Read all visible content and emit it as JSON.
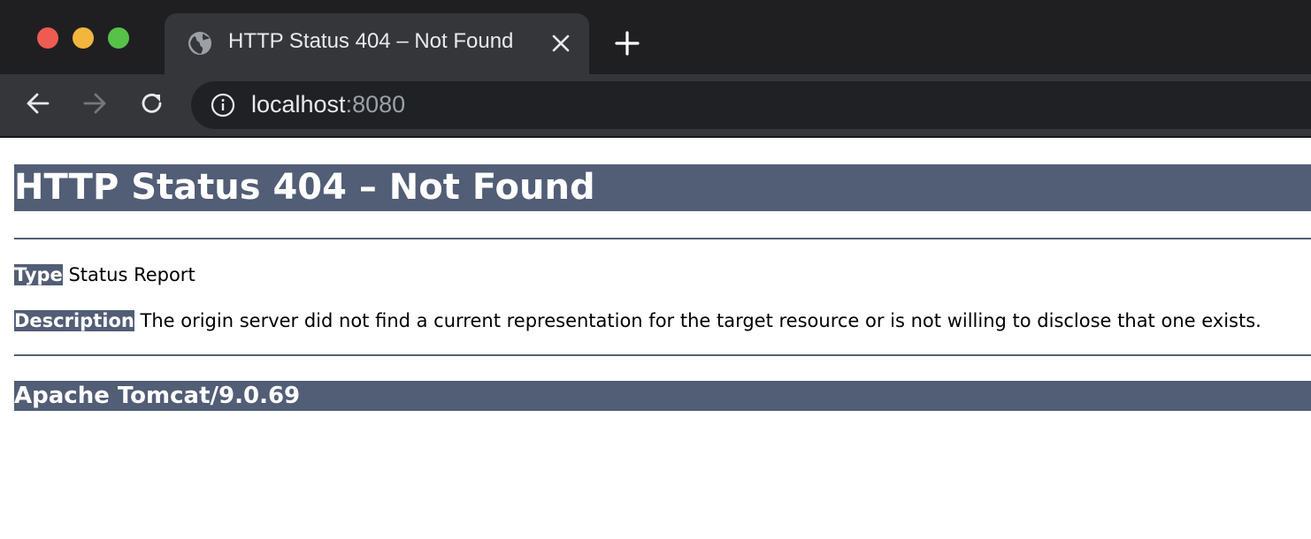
{
  "browser": {
    "traffic_lights": {
      "close_color": "#ee5b53",
      "minimize_color": "#f2b63e",
      "zoom_color": "#58c149"
    },
    "tab": {
      "icon": "globe-icon",
      "title": "HTTP Status 404 – Not Found",
      "close_icon": "close-icon"
    },
    "new_tab_icon": "plus-icon",
    "toolbar": {
      "back_icon": "arrow-left-icon",
      "forward_icon": "arrow-right-icon",
      "reload_icon": "reload-icon",
      "site_info_icon": "info-icon",
      "url_host": "localhost",
      "url_port": ":8080"
    }
  },
  "page": {
    "heading": "HTTP Status 404 – Not Found",
    "type_label": "Type",
    "type_value": " Status Report",
    "description_label": "Description",
    "description_value": " The origin server did not find a current representation for the target resource or is not willing to disclose that one exists.",
    "footer": "Apache Tomcat/9.0.69",
    "accent_color": "#525d76"
  }
}
